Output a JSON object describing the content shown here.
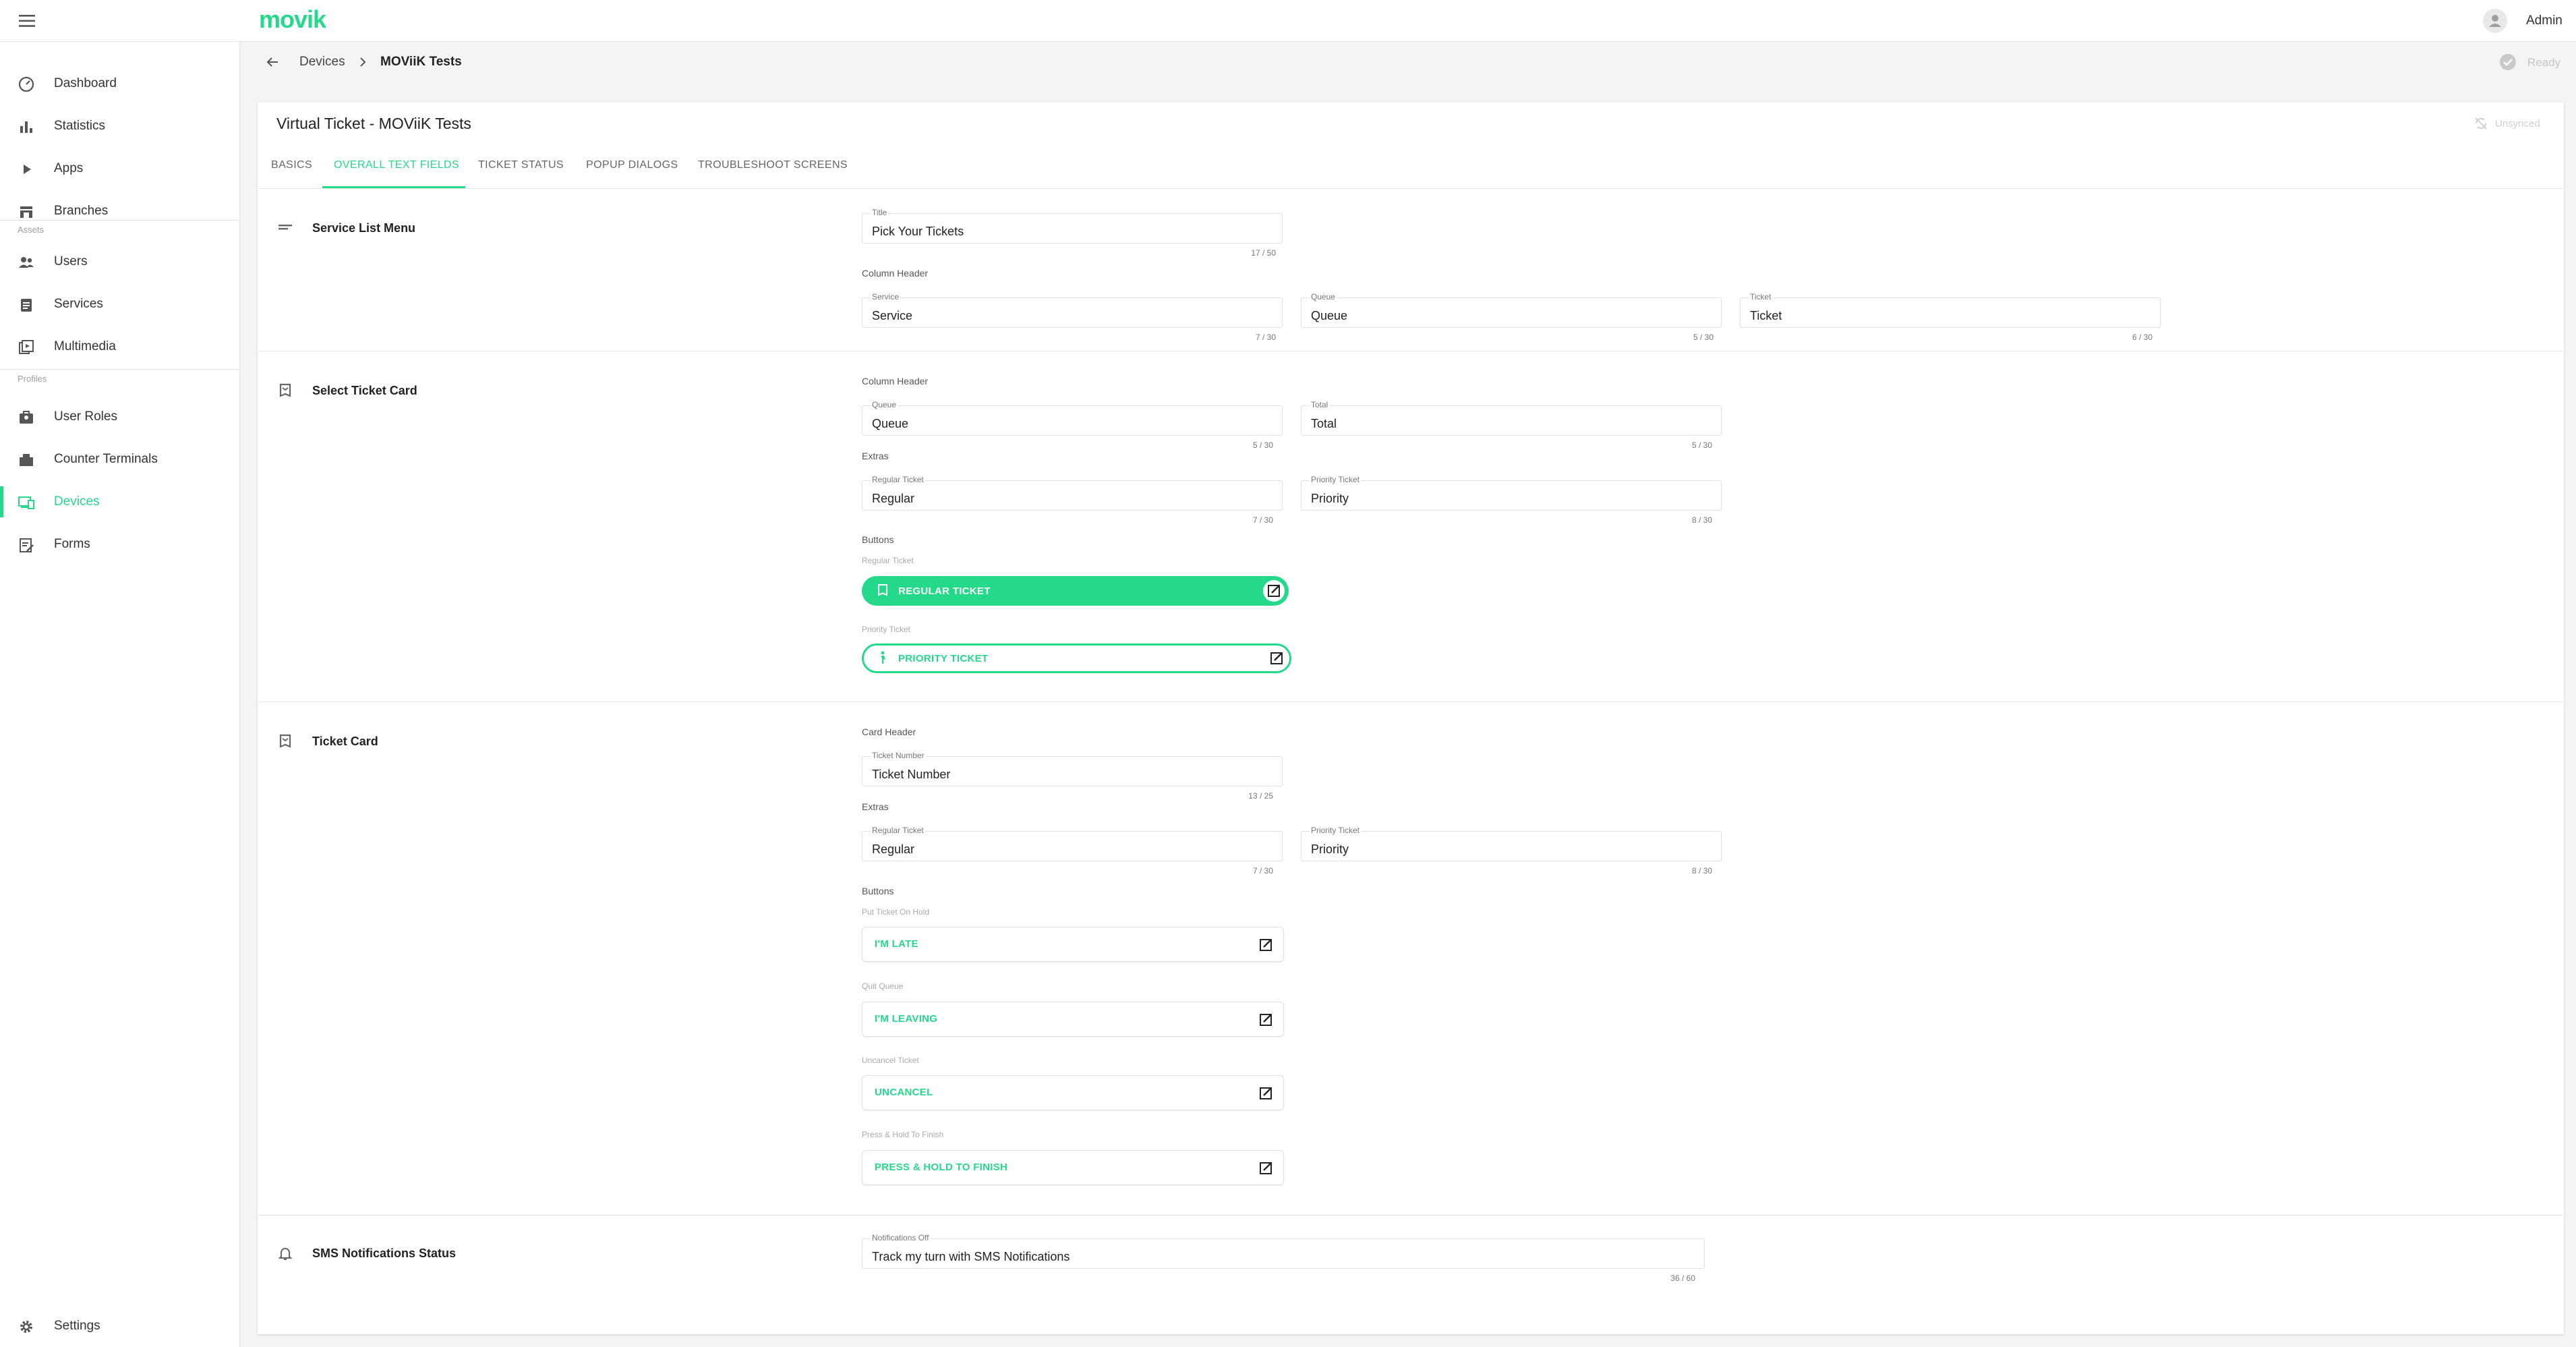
{
  "topbar": {
    "logo": "movik",
    "user": "Admin"
  },
  "breadcrumb": {
    "parent": "Devices",
    "current": "MOViiK Tests"
  },
  "status": {
    "ready": "Ready",
    "unsynced": "Unsynced"
  },
  "sidebar": {
    "items": [
      {
        "label": "Dashboard",
        "icon": "dashboard-icon"
      },
      {
        "label": "Statistics",
        "icon": "statistics-icon"
      },
      {
        "label": "Apps",
        "icon": "apps-icon"
      },
      {
        "label": "Branches",
        "icon": "branches-icon"
      }
    ],
    "assets_label": "Assets",
    "assets": [
      {
        "label": "Users",
        "icon": "users-icon"
      },
      {
        "label": "Services",
        "icon": "services-icon"
      },
      {
        "label": "Multimedia",
        "icon": "multimedia-icon"
      }
    ],
    "profiles_label": "Profiles",
    "profiles": [
      {
        "label": "User Roles",
        "icon": "user-roles-icon"
      },
      {
        "label": "Counter Terminals",
        "icon": "counter-terminals-icon"
      },
      {
        "label": "Devices",
        "icon": "devices-icon",
        "active": true
      },
      {
        "label": "Forms",
        "icon": "forms-icon"
      }
    ],
    "settings": "Settings"
  },
  "card": {
    "title": "Virtual Ticket -  MOViiK Tests",
    "tabs": [
      "BASICS",
      "OVERALL TEXT FIELDS",
      "TICKET STATUS",
      "POPUP DIALOGS",
      "TROUBLESHOOT SCREENS"
    ]
  },
  "service_list_menu": {
    "title": "Service List Menu",
    "title_field": {
      "label": "Title",
      "value": "Pick Your Tickets",
      "count": "17 / 50"
    },
    "column_header": "Column Header",
    "service": {
      "label": "Service",
      "value": "Service",
      "count": "7 / 30"
    },
    "queue": {
      "label": "Queue",
      "value": "Queue",
      "count": "5 / 30"
    },
    "ticket": {
      "label": "Ticket",
      "value": "Ticket",
      "count": "6 / 30"
    }
  },
  "select_ticket_card": {
    "title": "Select Ticket Card",
    "column_header": "Column Header",
    "queue": {
      "label": "Queue",
      "value": "Queue",
      "count": "5 / 30"
    },
    "total": {
      "label": "Total",
      "value": "Total",
      "count": "5 / 30"
    },
    "extras": "Extras",
    "regular": {
      "label": "Regular Ticket",
      "value": "Regular",
      "count": "7 / 30"
    },
    "priority": {
      "label": "Priority Ticket",
      "value": "Priority",
      "count": "8 / 30"
    },
    "buttons": "Buttons",
    "regular_button": {
      "label": "Regular Ticket",
      "text": "REGULAR TICKET"
    },
    "priority_button": {
      "label": "Priority Ticket",
      "text": "PRIORITY TICKET"
    }
  },
  "ticket_card": {
    "title": "Ticket Card",
    "card_header": "Card Header",
    "ticket_number": {
      "label": "Ticket Number",
      "value": "Ticket Number",
      "count": "13 / 25"
    },
    "extras": "Extras",
    "regular": {
      "label": "Regular Ticket",
      "value": "Regular",
      "count": "7 / 30"
    },
    "priority": {
      "label": "Priority Ticket",
      "value": "Priority",
      "count": "8 / 30"
    },
    "buttons": "Buttons",
    "hold": {
      "label": "Put Ticket On Hold",
      "text": "I'M LATE"
    },
    "quit": {
      "label": "Quit Queue",
      "text": "I'M LEAVING"
    },
    "uncancel": {
      "label": "Uncancel Ticket",
      "text": "UNCANCEL"
    },
    "finish": {
      "label": "Press & Hold To Finish",
      "text": "PRESS & HOLD TO FINISH"
    }
  },
  "sms": {
    "title": "SMS Notifications Status",
    "field": {
      "label": "Notifications Off",
      "value": "Track my turn with SMS Notifications",
      "count": "36 / 60"
    }
  },
  "colors": {
    "accent": "#25d98a"
  }
}
